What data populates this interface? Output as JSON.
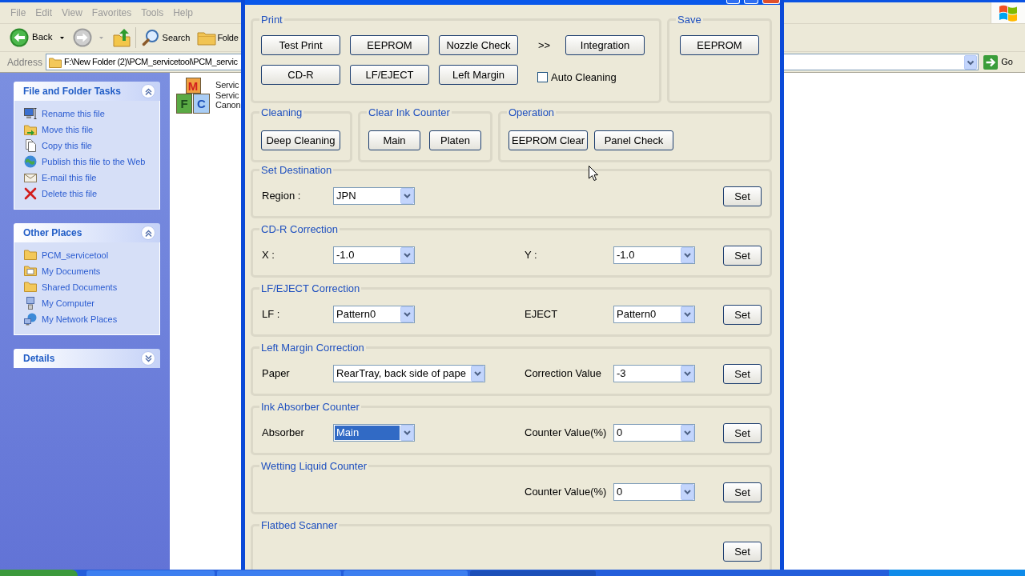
{
  "explorer": {
    "menu": [
      {
        "label": "File",
        "disabled": true
      },
      {
        "label": "Edit",
        "disabled": true
      },
      {
        "label": "View",
        "disabled": true
      },
      {
        "label": "Favorites",
        "disabled": true
      },
      {
        "label": "Tools",
        "disabled": true
      },
      {
        "label": "Help",
        "disabled": true
      }
    ],
    "toolbar": {
      "back": {
        "label": "Back",
        "disabled": false
      },
      "forward": {
        "disabled": true
      },
      "search": "Search",
      "folders": "Folde"
    },
    "address": {
      "label": "Address",
      "value": "F:\\New Folder (2)\\PCM_servicetool\\PCM_servic",
      "go": "Go"
    },
    "task_panes": [
      {
        "title": "File and Folder Tasks",
        "expanded": true,
        "items": [
          "Rename this file",
          "Move this file",
          "Copy this file",
          "Publish this file to the Web",
          "E-mail this file",
          "Delete this file"
        ]
      },
      {
        "title": "Other Places",
        "expanded": true,
        "items": [
          "PCM_servicetool",
          "My Documents",
          "Shared Documents",
          "My Computer",
          "My Network Places"
        ]
      },
      {
        "title": "Details",
        "expanded": false
      }
    ],
    "files": [
      {
        "icon_letters": [
          "M",
          "F",
          "C"
        ],
        "label_lines": [
          "Servic",
          "Servic",
          "Canon"
        ]
      }
    ]
  },
  "service_tool": {
    "print": {
      "title": "Print",
      "rows": [
        [
          "Test Print",
          "EEPROM",
          "Nozzle Check"
        ],
        [
          "CD-R",
          "LF/EJECT",
          "Left Margin"
        ]
      ],
      "more": ">>",
      "integration": "Integration",
      "auto_cleaning": {
        "label": "Auto Cleaning",
        "checked": false
      }
    },
    "save": {
      "title": "Save",
      "button": "EEPROM"
    },
    "button_groups": [
      {
        "title": "Cleaning",
        "buttons": [
          "Deep Cleaning"
        ]
      },
      {
        "title": "Clear Ink Counter",
        "buttons": [
          "Main",
          "Platen"
        ]
      },
      {
        "title": "Operation",
        "buttons": [
          "EEPROM Clear",
          "Panel Check"
        ]
      }
    ],
    "settings": [
      {
        "title": "Set Destination",
        "left": {
          "label": "Region :",
          "value": "JPN",
          "focused": false
        },
        "set_button": "Set"
      },
      {
        "title": "CD-R Correction",
        "left": {
          "label": "X :",
          "value": "-1.0",
          "focused": false
        },
        "right": {
          "label": "Y :",
          "value": "-1.0",
          "focused": false
        },
        "set_button": "Set"
      },
      {
        "title": "LF/EJECT Correction",
        "left": {
          "label": "LF :",
          "value": "Pattern0",
          "focused": false
        },
        "right": {
          "label": "EJECT",
          "value": "Pattern0",
          "focused": false
        },
        "set_button": "Set"
      },
      {
        "title": "Left Margin Correction",
        "left": {
          "label": "Paper",
          "value": "RearTray, back side of pape",
          "focused": false
        },
        "right": {
          "label": "Correction Value",
          "value": "-3",
          "focused": false
        },
        "set_button": "Set"
      },
      {
        "title": "Ink Absorber Counter",
        "left": {
          "label": "Absorber",
          "value": "Main",
          "focused": true
        },
        "right": {
          "label": "Counter Value(%)",
          "value": "0",
          "focused": false
        },
        "set_button": "Set"
      },
      {
        "title": "Wetting Liquid Counter",
        "right": {
          "label": "Counter Value(%)",
          "value": "0",
          "focused": false
        },
        "set_button": "Set"
      },
      {
        "title": "Flatbed Scanner",
        "set_button": "Set"
      }
    ]
  }
}
